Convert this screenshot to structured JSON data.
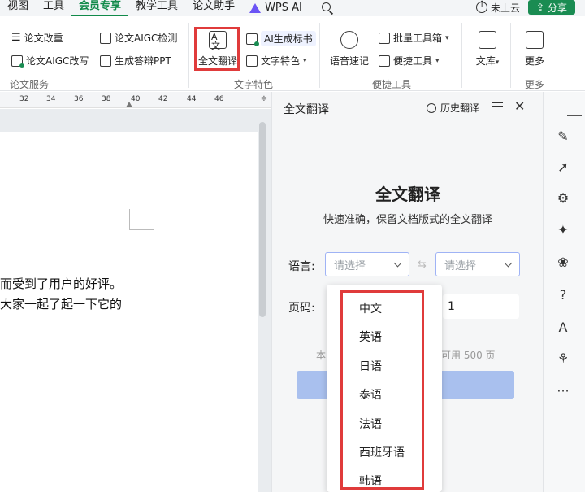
{
  "menubar": {
    "items": [
      "视图",
      "工具",
      "会员专享",
      "教学工具",
      "论文助手",
      "WPS AI"
    ],
    "active_index": 2,
    "cloud_label": "未上云",
    "share_label": "分享"
  },
  "ribbon": {
    "paper_service": {
      "items": [
        "论文改重",
        "论文AIGC检测",
        "论文AIGC改写",
        "生成答辩PPT"
      ],
      "group_label": "论文服务"
    },
    "text_features": {
      "full_translate": "全文翻译",
      "ai_generate": "AI生成标书",
      "text_feature": "文字特色",
      "group_label": "文字特色"
    },
    "tools": {
      "speech_notes": "语音速记",
      "batch_toolbox": "批量工具箱",
      "handy_tools": "便捷工具",
      "group_label": "便捷工具"
    },
    "library": {
      "label": "文库"
    },
    "more": {
      "label": "更多",
      "group_label": "更多"
    }
  },
  "ruler": {
    "ticks": [
      "32",
      "34",
      "36",
      "38",
      "40",
      "42",
      "44",
      "46"
    ]
  },
  "document": {
    "lines": [
      "而受到了用户的好评。",
      "大家一起了起一下它的"
    ]
  },
  "panel": {
    "title": "全文翻译",
    "history": "历史翻译",
    "hero_title": "全文翻译",
    "hero_subtitle": "快速准确，保留文档版式的全文翻译",
    "language_label": "语言:",
    "source_placeholder": "请选择",
    "target_placeholder": "请选择",
    "page_label": "页码:",
    "page_value": "1",
    "hint_left": "本",
    "hint_right": "可用 500 页"
  },
  "dropdown": {
    "options": [
      "中文",
      "英语",
      "日语",
      "泰语",
      "法语",
      "西班牙语",
      "韩语"
    ]
  },
  "sidebar": {
    "icons": [
      "collapse-icon",
      "pen-icon",
      "cursor-icon",
      "sliders-icon",
      "magic-tools-icon",
      "apps-icon",
      "help-icon",
      "translate-icon",
      "shirt-icon",
      "more-icon"
    ]
  },
  "colors": {
    "accent_green": "#118a4a",
    "highlight_red": "#e03b3b",
    "button_blue": "#a9c0ee"
  }
}
